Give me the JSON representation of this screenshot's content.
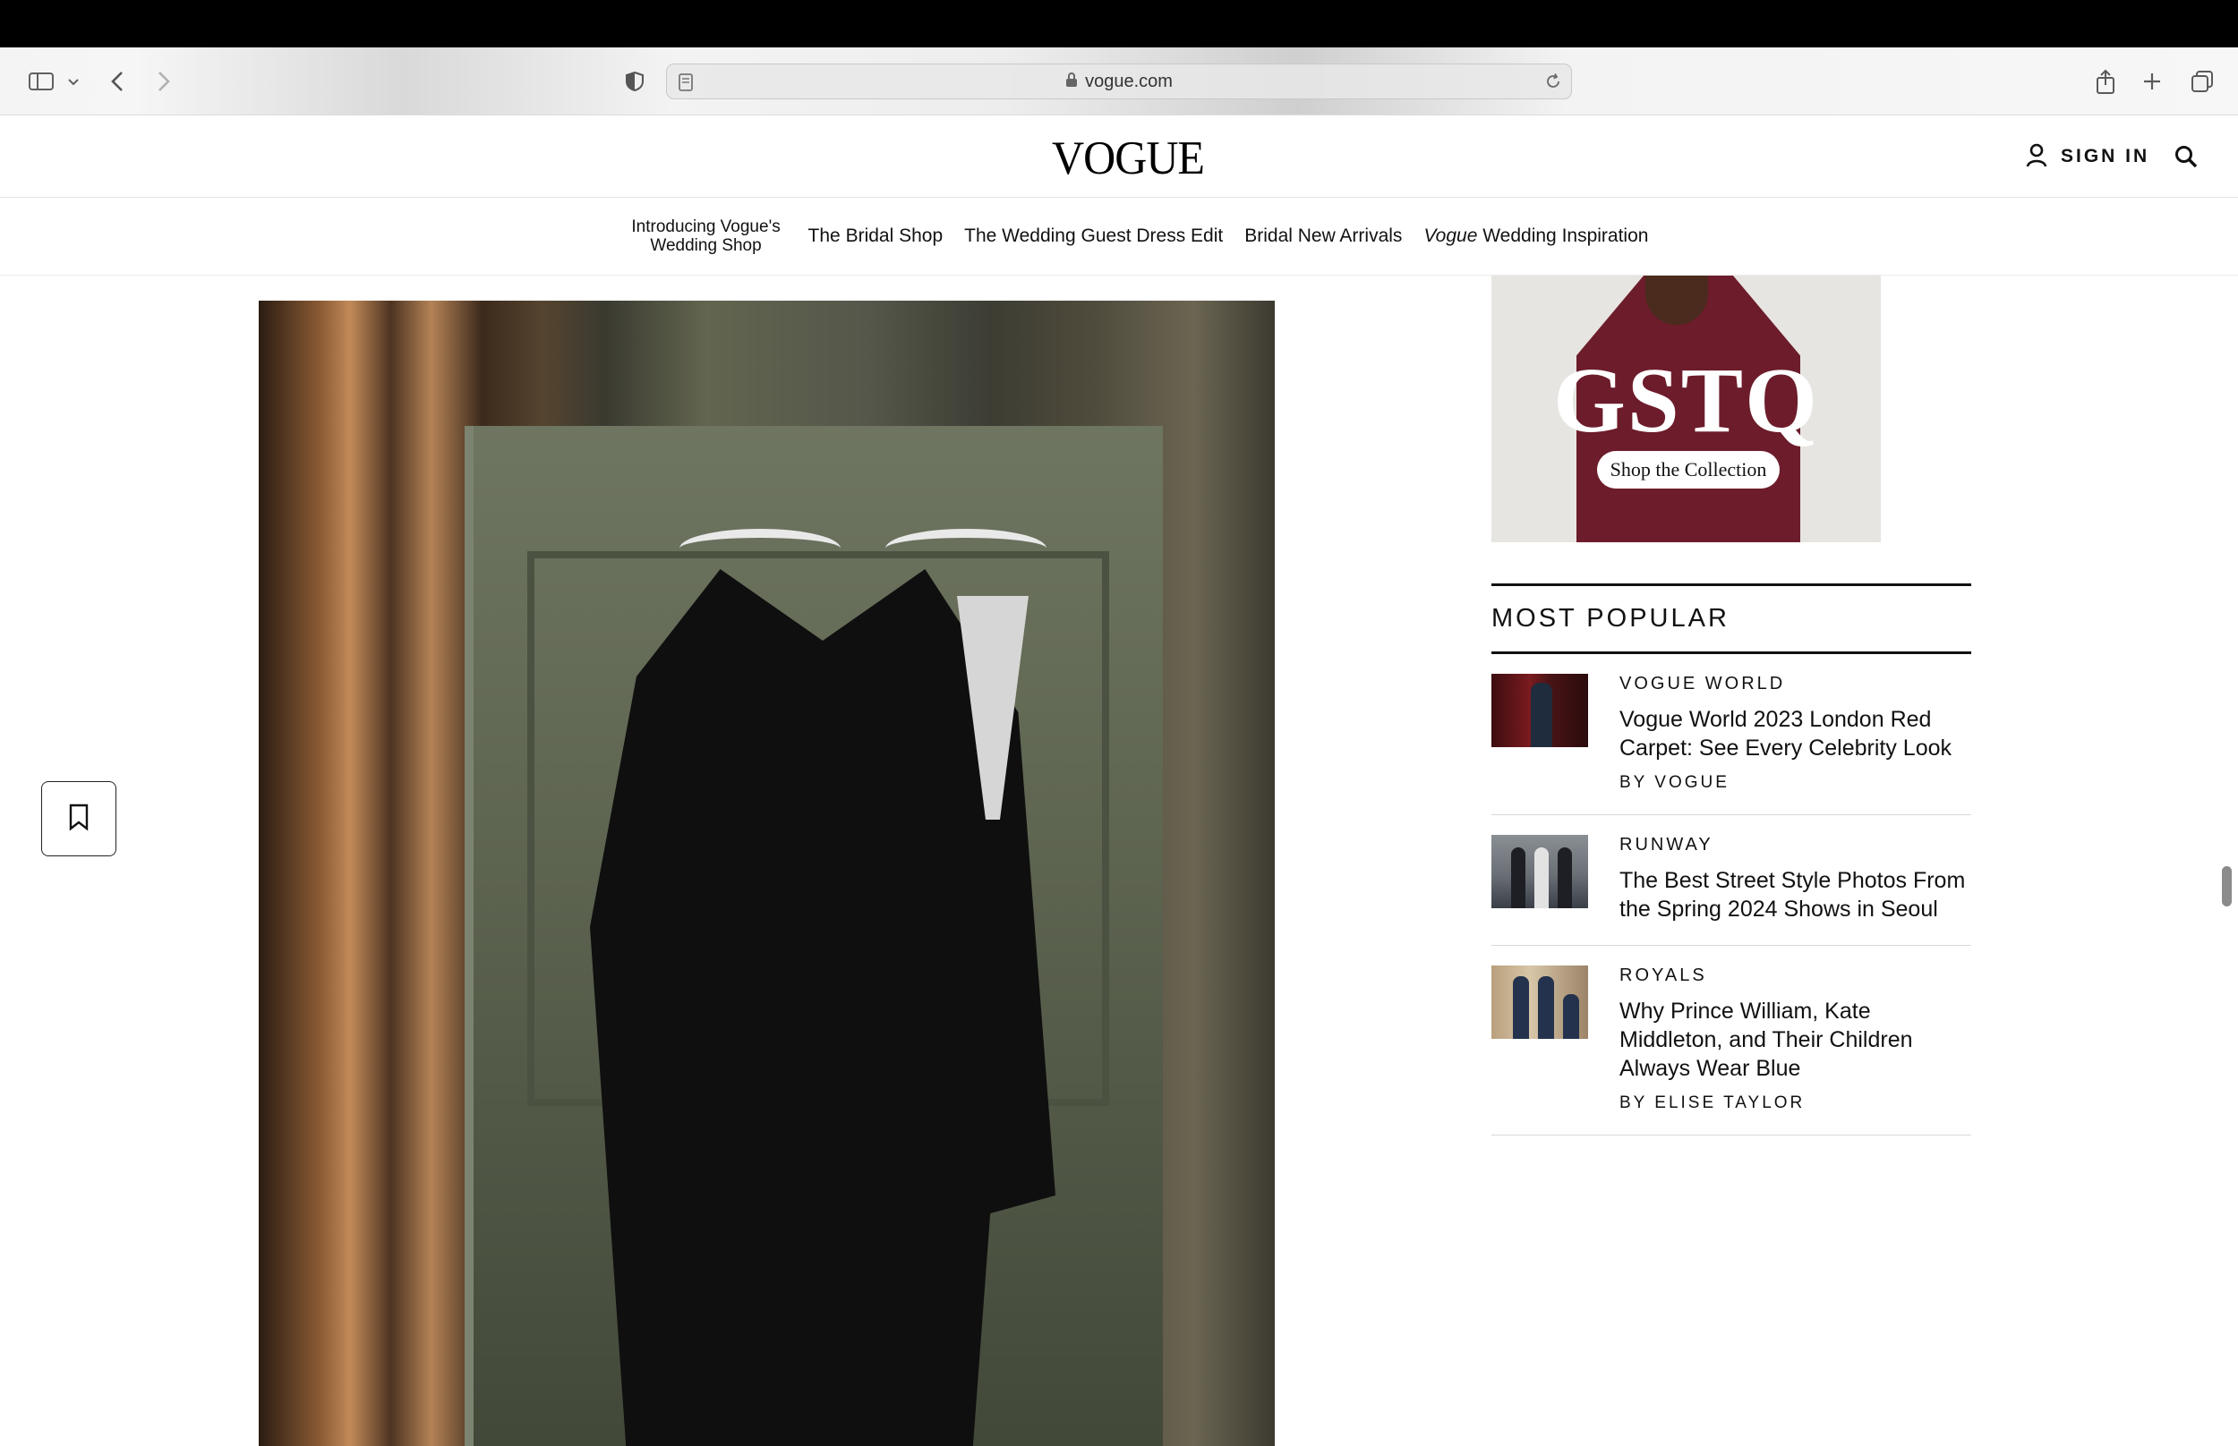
{
  "browser": {
    "url": "vogue.com"
  },
  "site": {
    "logo": "VOGUE",
    "sign_in": "SIGN IN"
  },
  "nav": {
    "items": [
      {
        "label": "Introducing Vogue's Wedding Shop"
      },
      {
        "label": "The Bridal Shop"
      },
      {
        "label": "The Wedding Guest Dress Edit"
      },
      {
        "label": "Bridal New Arrivals"
      },
      {
        "label_em": "Vogue",
        "label": " Wedding Inspiration"
      }
    ]
  },
  "ad": {
    "brand": "GSTQ",
    "cta": "Shop the Collection"
  },
  "most_popular": {
    "heading": "MOST POPULAR",
    "items": [
      {
        "category": "VOGUE WORLD",
        "title": "Vogue World 2023 London Red Carpet: See Every Celebrity Look",
        "byline": "BY VOGUE"
      },
      {
        "category": "RUNWAY",
        "title": "The Best Street Style Photos From the Spring 2024 Shows in Seoul",
        "byline": ""
      },
      {
        "category": "ROYALS",
        "title": "Why Prince William, Kate Middleton, and Their Children Always Wear Blue",
        "byline": "BY ELISE TAYLOR"
      }
    ]
  },
  "icons": [
    "sidebar-icon",
    "chevron-down-icon",
    "back-icon",
    "forward-icon",
    "shield-icon",
    "reader-icon",
    "lock-icon",
    "reload-icon",
    "share-icon",
    "new-tab-icon",
    "tabs-icon",
    "user-icon",
    "search-icon",
    "bookmark-icon"
  ]
}
